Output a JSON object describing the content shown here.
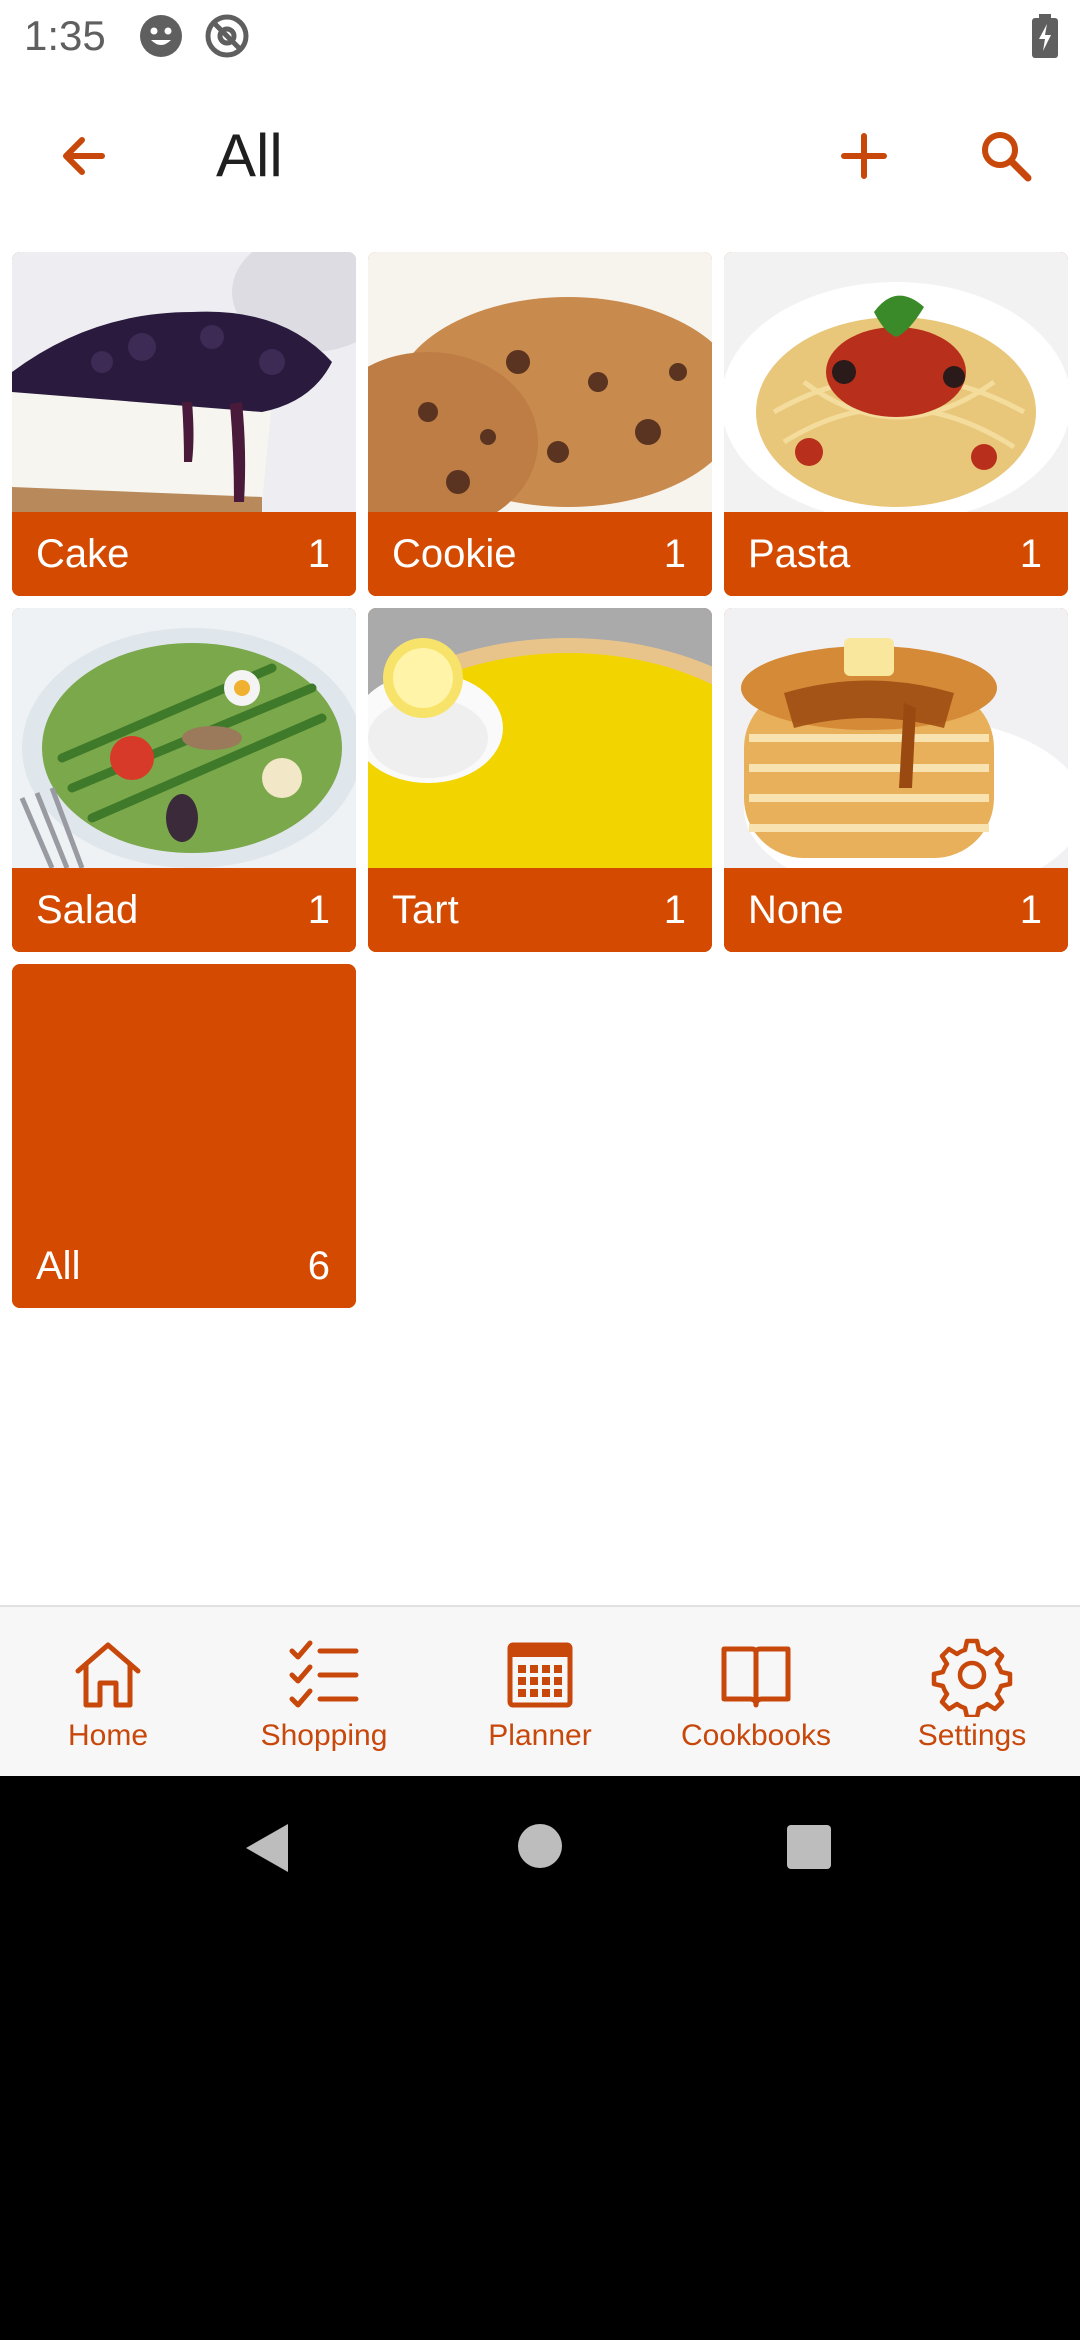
{
  "status_bar": {
    "time": "1:35",
    "icons": [
      "face-icon",
      "at-sign-icon",
      "battery-charging-icon"
    ]
  },
  "app_bar": {
    "title": "All",
    "back_icon": "arrow-left-icon",
    "add_icon": "plus-icon",
    "search_icon": "search-icon"
  },
  "categories": [
    {
      "name": "Cake",
      "count": "1"
    },
    {
      "name": "Cookie",
      "count": "1"
    },
    {
      "name": "Pasta",
      "count": "1"
    },
    {
      "name": "Salad",
      "count": "1"
    },
    {
      "name": "Tart",
      "count": "1"
    },
    {
      "name": "None",
      "count": "1"
    },
    {
      "name": "All",
      "count": "6"
    }
  ],
  "bottom_nav": [
    {
      "label": "Home",
      "icon": "home-icon"
    },
    {
      "label": "Shopping",
      "icon": "checklist-icon"
    },
    {
      "label": "Planner",
      "icon": "calendar-icon"
    },
    {
      "label": "Cookbooks",
      "icon": "book-icon"
    },
    {
      "label": "Settings",
      "icon": "gear-icon"
    }
  ],
  "system_nav": [
    "back-triangle-icon",
    "home-circle-icon",
    "recents-square-icon"
  ],
  "colors": {
    "accent": "#d44a00",
    "icon_accent": "#c8470a",
    "nav_background": "#f7f7f7"
  }
}
